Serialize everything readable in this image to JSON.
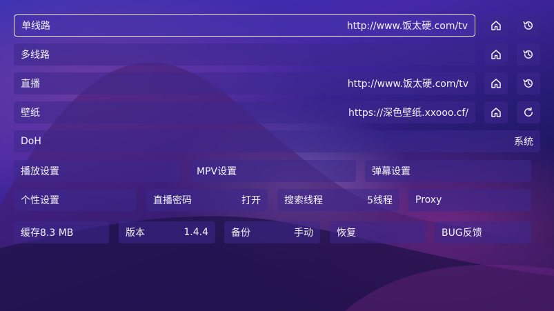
{
  "rows": {
    "single_line": {
      "label": "单线路",
      "value": "http://www.饭太硬.com/tv"
    },
    "multi_line": {
      "label": "多线路",
      "value": ""
    },
    "live": {
      "label": "直播",
      "value": "http://www.饭太硬.com/tv"
    },
    "wallpaper": {
      "label": "壁纸",
      "value": "https://深色壁纸.xxooo.cf/"
    },
    "doh": {
      "label": "DoH",
      "value": "系统"
    }
  },
  "settings_row": {
    "playback": "播放设置",
    "mpv": "MPV设置",
    "danmaku": "弹幕设置"
  },
  "options_row": {
    "personal": "个性设置",
    "live_password": {
      "label": "直播密码",
      "value": "打开"
    },
    "search_threads": {
      "label": "搜索线程",
      "value": "5线程"
    },
    "proxy": "Proxy"
  },
  "bottom_row": {
    "cache": "缓存8.3 MB",
    "version": {
      "label": "版本",
      "value": "1.4.4"
    },
    "backup": {
      "label": "备份",
      "value": "手动"
    },
    "restore": "恢复",
    "bug_feedback": "BUG反馈"
  },
  "icons": {
    "home": "home-icon",
    "history": "history-icon",
    "refresh": "refresh-icon"
  }
}
